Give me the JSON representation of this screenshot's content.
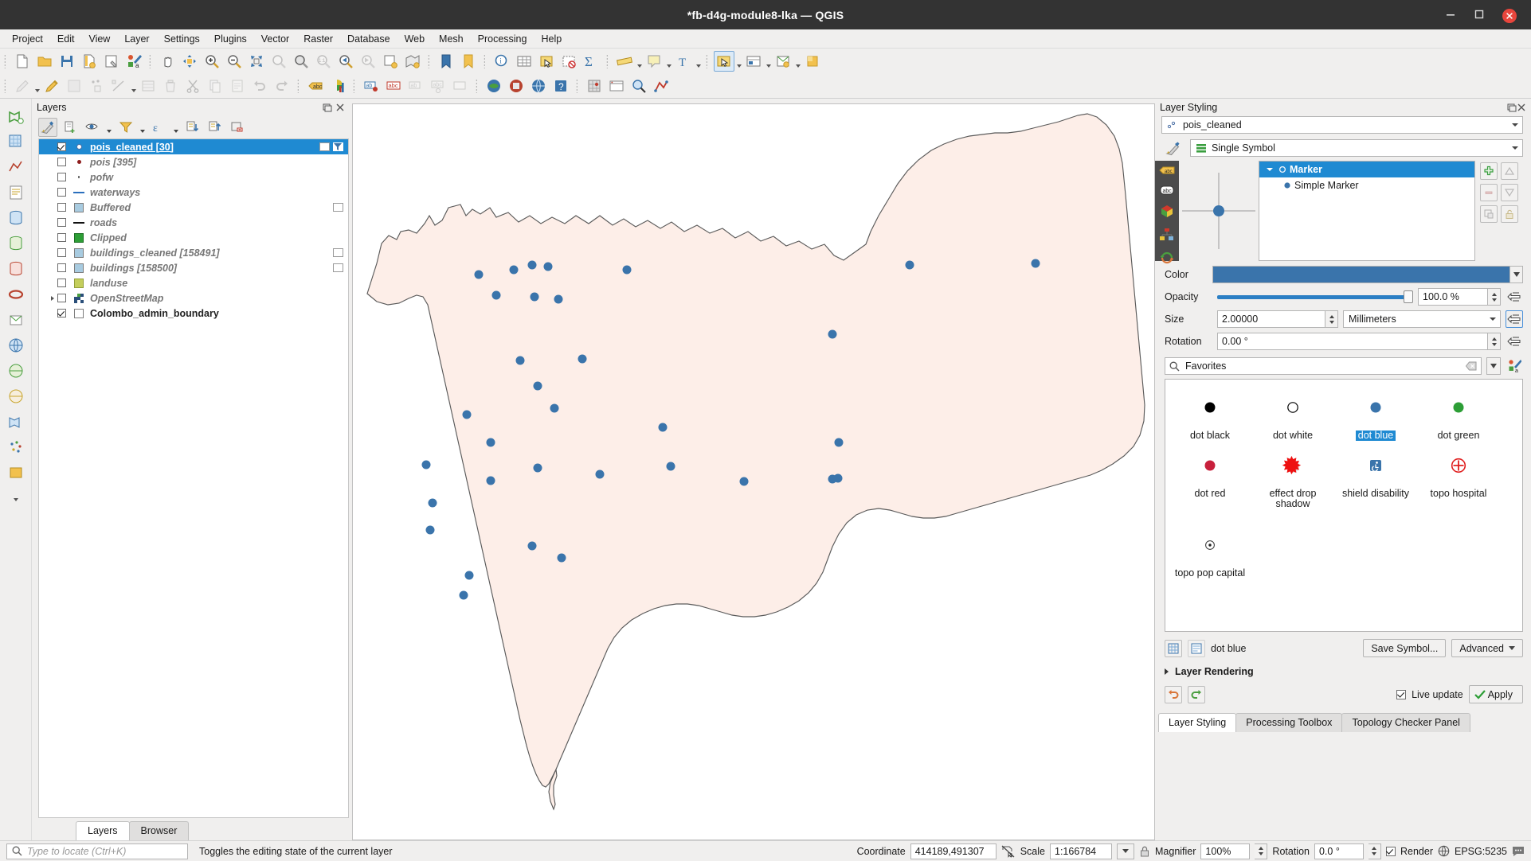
{
  "window": {
    "title": "*fb-d4g-module8-lka — QGIS",
    "buttons": {
      "minimize": "minimize",
      "maximize": "maximize",
      "close": "close"
    }
  },
  "menubar": {
    "items": [
      {
        "label": "Project",
        "accel": "P"
      },
      {
        "label": "Edit",
        "accel": "E"
      },
      {
        "label": "View",
        "accel": "V"
      },
      {
        "label": "Layer",
        "accel": "L"
      },
      {
        "label": "Settings",
        "accel": "S"
      },
      {
        "label": "Plugins",
        "accel": "P"
      },
      {
        "label": "Vector",
        "accel": "o"
      },
      {
        "label": "Raster",
        "accel": "R"
      },
      {
        "label": "Database",
        "accel": "D"
      },
      {
        "label": "Web",
        "accel": "W"
      },
      {
        "label": "Mesh",
        "accel": "M"
      },
      {
        "label": "Processing",
        "accel": "c"
      },
      {
        "label": "Help",
        "accel": "H"
      }
    ]
  },
  "toolbar_top": {
    "icons": [
      "new-project-icon",
      "open-project-icon",
      "save-project-icon",
      "save-project-as-icon",
      "new-print-layout-icon",
      "style-manager-icon",
      "pan-map-icon",
      "pan-to-selection-icon",
      "zoom-in-icon",
      "zoom-out-icon",
      "zoom-full-icon",
      "zoom-to-selection-icon",
      "zoom-to-layer-icon",
      "zoom-native-icon",
      "zoom-last-icon",
      "zoom-next-icon",
      "refresh-icon",
      "new-map-view-icon",
      "show-bookmarks-icon",
      "new-bookmark-icon",
      "identify-features-icon",
      "open-attribute-table-icon",
      "select-features-icon",
      "deselect-icon",
      "sum-statistics-icon",
      "measure-line-icon",
      "map-tips-icon",
      "text-annotation-icon",
      "select-by-location-icon",
      "select-by-expression-icon",
      "open-data-source-manager-icon",
      "new-virtual-layer-icon",
      "add-delimited-text-icon"
    ]
  },
  "toolbar_second": {
    "icons": [
      "current-edits-icon",
      "toggle-editing-icon",
      "save-layer-edits-icon",
      "add-feature-icon",
      "vertex-tool-icon",
      "modify-attributes-icon",
      "delete-selected-icon",
      "cut-features-icon",
      "copy-features-icon",
      "paste-features-icon",
      "undo-icon",
      "redo-icon",
      "label-icon",
      "diagram-icon",
      "pin-labels-icon",
      "show-hide-labels-icon",
      "move-label-icon",
      "rotate-label-icon",
      "change-label-icon",
      "python-console-icon",
      "plugin-manager-icon",
      "metasearch-icon",
      "help-icon",
      "georeferencer-icon",
      "qgis2web-icon",
      "osm-place-search-icon",
      "topology-checker-icon"
    ]
  },
  "left_rail": {
    "icons": [
      "add-vector-layer-icon",
      "add-raster-layer-icon",
      "add-mesh-layer-icon",
      "add-delimited-text-layer-icon",
      "add-postgis-layer-icon",
      "add-spatialite-layer-icon",
      "add-mssql-layer-icon",
      "add-oracle-layer-icon",
      "add-db2-layer-icon",
      "add-virtual-layer-icon",
      "add-wms-layer-icon",
      "add-wcs-layer-icon",
      "add-wfs-layer-icon",
      "add-afs-layer-icon",
      "add-vectortile-layer-icon",
      "add-pointcloud-layer-icon"
    ]
  },
  "layers_panel": {
    "title": "Layers",
    "toolbar": [
      {
        "name": "open-layer-styling-panel",
        "active": true
      },
      {
        "name": "add-group"
      },
      {
        "name": "manage-map-themes"
      },
      {
        "name": "filter-legend-by-map-content"
      },
      {
        "name": "filter-legend-by-expression"
      },
      {
        "name": "expand-all"
      },
      {
        "name": "collapse-all"
      },
      {
        "name": "remove-layer-or-group"
      }
    ],
    "items": [
      {
        "label": "pois_cleaned [30]",
        "checked": true,
        "selected": true,
        "symbol": "dot-ring-blue",
        "bold": true,
        "extra_buttons": [
          "layer-notes",
          "filter-indicator"
        ]
      },
      {
        "label": "pois [395]",
        "checked": false,
        "symbol": "dot-dark-red"
      },
      {
        "label": "pofw",
        "checked": false,
        "symbol": "dot-tiny-grey"
      },
      {
        "label": "waterways",
        "checked": false,
        "symbol": "line-blue"
      },
      {
        "label": "Buffered",
        "checked": false,
        "symbol": "swatch-lightblue",
        "extra_buttons": [
          "layer-notes"
        ]
      },
      {
        "label": "roads",
        "checked": false,
        "symbol": "line-black"
      },
      {
        "label": "Clipped",
        "checked": false,
        "symbol": "swatch-green"
      },
      {
        "label": "buildings_cleaned [158491]",
        "checked": false,
        "symbol": "swatch-lightblue",
        "extra_buttons": [
          "layer-notes"
        ]
      },
      {
        "label": "buildings [158500]",
        "checked": false,
        "symbol": "swatch-lightblue",
        "extra_buttons": [
          "layer-notes"
        ]
      },
      {
        "label": "landuse",
        "checked": false,
        "symbol": "swatch-olive"
      },
      {
        "label": "OpenStreetMap",
        "checked": false,
        "symbol": "raster-tile",
        "expandable": true
      },
      {
        "label": "Colombo_admin_boundary",
        "checked": true,
        "symbol": "swatch-white",
        "bold": true
      }
    ],
    "tabs": [
      {
        "label": "Layers",
        "active": true
      },
      {
        "label": "Browser",
        "active": false
      }
    ]
  },
  "map": {
    "background": "#ffffff",
    "polygon_fill": "#fdeee8",
    "polygon_stroke": "#555555",
    "point_color": "#3a74ab",
    "point_count": 30
  },
  "style_panel": {
    "title": "Layer Styling",
    "layer_combo": "pois_cleaned",
    "renderer_combo": "Single Symbol",
    "sidebar_icons": [
      "symbology-icon",
      "labels-icon",
      "masks-icon",
      "3d-view-icon",
      "diagrams-icon",
      "history-icon"
    ],
    "symbol_tree": [
      {
        "label": "Marker",
        "selected": true,
        "indent": 0,
        "icon": "marker-ring-icon"
      },
      {
        "label": "Simple Marker",
        "selected": false,
        "indent": 1,
        "icon": "dot-blue-icon"
      }
    ],
    "tree_buttons": [
      "add-symbol-layer",
      "remove-symbol-layer",
      "duplicate-symbol-layer",
      "move-up",
      "move-down",
      "lock-colors"
    ],
    "properties": {
      "color_label": "Color",
      "color_value": "#3a74ab",
      "opacity_label": "Opacity",
      "opacity_value": "100.0 %",
      "size_label": "Size",
      "size_value": "2.00000",
      "size_unit": "Millimeters",
      "rotation_label": "Rotation",
      "rotation_value": "0.00 °"
    },
    "search": {
      "value": "Favorites",
      "placeholder": "Favorites",
      "icon": "search-icon",
      "clear_icon": "clear-icon",
      "dropdown_icon": "chevron-down-icon",
      "style_manager_icon": "style-manager-icon"
    },
    "gallery": [
      {
        "label": "dot black",
        "glyph": "circle-filled",
        "color": "#000000",
        "selected": false
      },
      {
        "label": "dot white",
        "glyph": "circle-outline",
        "color": "#ffffff",
        "selected": false
      },
      {
        "label": "dot blue",
        "glyph": "circle-filled",
        "color": "#3a74ab",
        "selected": true
      },
      {
        "label": "dot green",
        "glyph": "circle-filled",
        "color": "#2d9e36",
        "selected": false
      },
      {
        "label": "dot red",
        "glyph": "circle-filled",
        "color": "#c8203c",
        "selected": false
      },
      {
        "label": "effect drop shadow",
        "glyph": "starburst",
        "color": "#ee1111",
        "selected": false
      },
      {
        "label": "shield disability",
        "glyph": "disability-shield",
        "color": "#3a74ab",
        "selected": false
      },
      {
        "label": "topo hospital",
        "glyph": "hospital-cross",
        "color": "#e02020",
        "selected": false
      },
      {
        "label": "topo pop capital",
        "glyph": "circle-dot-outline",
        "color": "#333333",
        "selected": false
      }
    ],
    "footer": {
      "view_grid_icon": "grid-view-icon",
      "view_list_icon": "list-view-icon",
      "current_symbol": "dot blue",
      "save_symbol_label": "Save Symbol...",
      "advanced_label": "Advanced"
    },
    "layer_rendering_label": "Layer Rendering",
    "undo_icon": "undo-icon",
    "redo_icon": "redo-icon",
    "live_update_label": "Live update",
    "live_update_checked": true,
    "apply_label": "Apply"
  },
  "dock_tabs": [
    {
      "label": "Layer Styling",
      "active": true
    },
    {
      "label": "Processing Toolbox",
      "active": false
    },
    {
      "label": "Topology Checker Panel",
      "active": false
    }
  ],
  "statusbar": {
    "locate_placeholder": "Type to locate (Ctrl+K)",
    "message": "Toggles the editing state of the current layer",
    "coordinate_label": "Coordinate",
    "coordinate_value": "414189,491307",
    "maptips_icon": "map-tips-icon",
    "scale_label": "Scale",
    "scale_value": "1:166784",
    "lock_icon": "lock-icon",
    "magnifier_label": "Magnifier",
    "magnifier_value": "100%",
    "rotation_label": "Rotation",
    "rotation_value": "0.0 °",
    "render_label": "Render",
    "render_checked": true,
    "crs_label": "EPSG:5235",
    "messages_icon": "messages-icon"
  }
}
